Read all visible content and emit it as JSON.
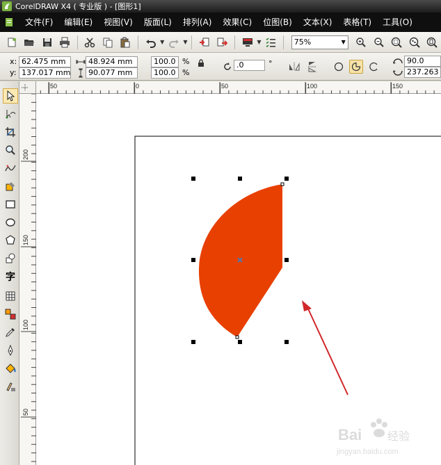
{
  "window": {
    "title": "CorelDRAW X4 ( 专业版 ) - [图形1]"
  },
  "menu": {
    "items": [
      {
        "label": "文件(F)"
      },
      {
        "label": "编辑(E)"
      },
      {
        "label": "视图(V)"
      },
      {
        "label": "版面(L)"
      },
      {
        "label": "排列(A)"
      },
      {
        "label": "效果(C)"
      },
      {
        "label": "位图(B)"
      },
      {
        "label": "文本(X)"
      },
      {
        "label": "表格(T)"
      },
      {
        "label": "工具(O)"
      }
    ]
  },
  "toolbar": {
    "icons": [
      "new-icon",
      "open-icon",
      "save-icon",
      "print-icon",
      "cut-icon",
      "copy-icon",
      "paste-icon",
      "undo-icon",
      "redo-icon",
      "import-icon",
      "export-icon",
      "application-launcher-icon",
      "options-icon",
      "zoom-in-icon",
      "zoom-out-icon",
      "zoom-selected-icon",
      "zoom-all-icon",
      "zoom-page-icon"
    ],
    "zoom_level": "75%"
  },
  "properties": {
    "x_label": "x:",
    "y_label": "y:",
    "x_value": "62.475 mm",
    "y_value": "137.017 mm",
    "width_value": "48.924 mm",
    "height_value": "90.077 mm",
    "scale_x": "100.0",
    "scale_y": "100.0",
    "percent": "%",
    "rotation": ".0",
    "degree": "°",
    "start_angle": "90.0",
    "end_angle": "237.263"
  },
  "ruler": {
    "h_labels": [
      "50",
      "0",
      "50",
      "100",
      "150"
    ],
    "v_labels": [
      "200",
      "150",
      "100",
      "50"
    ]
  },
  "colors": {
    "shape_fill": "#e84000",
    "arrow": "#d0272b",
    "center_marker": "#3b7ec8"
  },
  "tools": [
    "pick-tool-icon",
    "shape-tool-icon",
    "crop-tool-icon",
    "zoom-tool-icon",
    "freehand-tool-icon",
    "smart-fill-tool-icon",
    "rectangle-tool-icon",
    "ellipse-tool-icon",
    "polygon-tool-icon",
    "basic-shapes-tool-icon",
    "text-tool-icon",
    "table-tool-icon",
    "interactive-blend-tool-icon",
    "eyedropper-tool-icon",
    "outline-tool-icon",
    "fill-tool-icon",
    "interactive-fill-tool-icon"
  ],
  "text_tool_glyph": "字",
  "watermark": {
    "brand": "Bai",
    "suffix": "经验",
    "url": "jingyan.baidu.com"
  }
}
